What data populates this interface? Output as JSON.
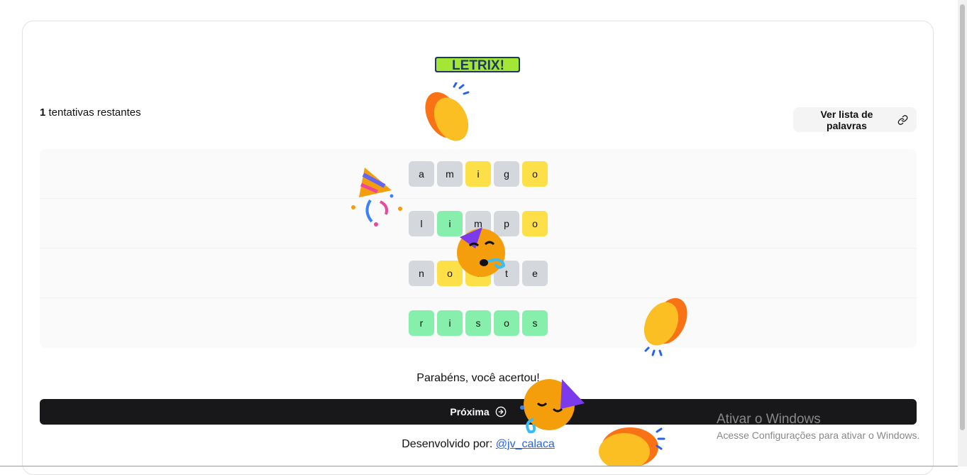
{
  "logo_text": "LETRIX!",
  "attempts": {
    "count": "1",
    "label": "tentativas restantes"
  },
  "wordlist_button": "Ver lista de palavras",
  "rows": [
    [
      {
        "l": "a",
        "s": "gray"
      },
      {
        "l": "m",
        "s": "gray"
      },
      {
        "l": "i",
        "s": "yellow"
      },
      {
        "l": "g",
        "s": "gray"
      },
      {
        "l": "o",
        "s": "yellow"
      }
    ],
    [
      {
        "l": "l",
        "s": "gray"
      },
      {
        "l": "i",
        "s": "green"
      },
      {
        "l": "m",
        "s": "gray"
      },
      {
        "l": "p",
        "s": "gray"
      },
      {
        "l": "o",
        "s": "yellow"
      }
    ],
    [
      {
        "l": "n",
        "s": "gray"
      },
      {
        "l": "o",
        "s": "yellow"
      },
      {
        "l": "i",
        "s": "yellow"
      },
      {
        "l": "t",
        "s": "gray"
      },
      {
        "l": "e",
        "s": "gray"
      }
    ],
    [
      {
        "l": "r",
        "s": "green"
      },
      {
        "l": "i",
        "s": "green"
      },
      {
        "l": "s",
        "s": "green"
      },
      {
        "l": "o",
        "s": "green"
      },
      {
        "l": "s",
        "s": "green"
      }
    ]
  ],
  "message": "Parabéns, você acertou!",
  "next_button": "Próxima",
  "footer": {
    "prefix": "Desenvolvido por:",
    "link": "@jv_calaca"
  },
  "windows_watermark": {
    "title": "Ativar o Windows",
    "subtitle": "Acesse Configurações para ativar o Windows."
  },
  "colors": {
    "gray": "#d4d7dc",
    "yellow": "#fde047",
    "green": "#86efac",
    "button": "#18181b",
    "link": "#2563eb"
  }
}
